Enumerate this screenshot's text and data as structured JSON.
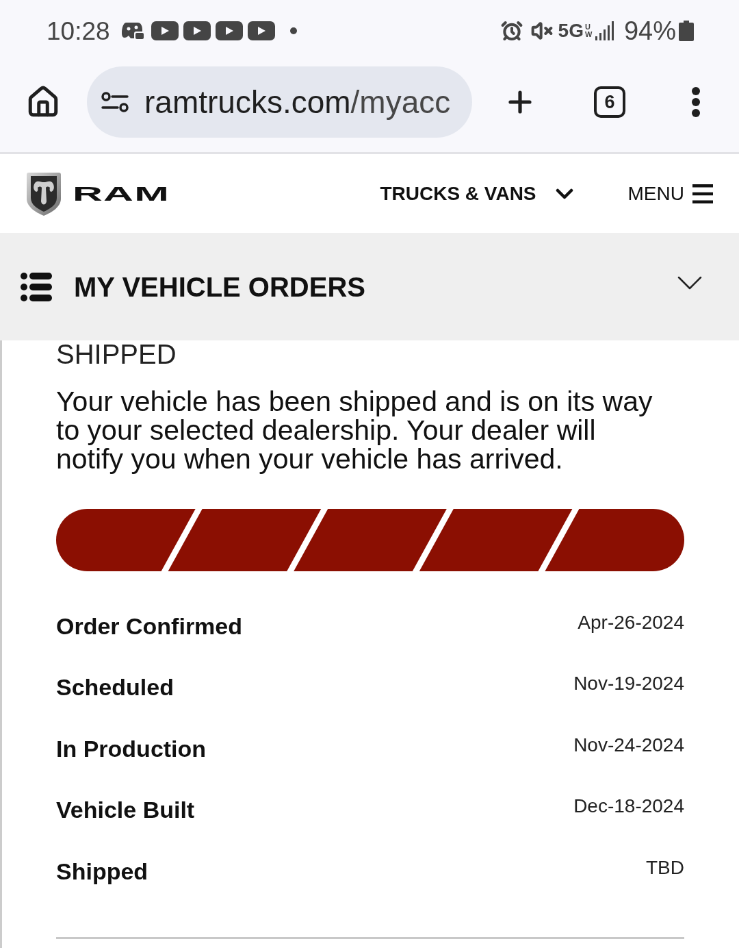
{
  "status_bar": {
    "time": "10:28",
    "network": "5G",
    "network_sub": "UW",
    "battery": "94%"
  },
  "browser": {
    "url_host": "ramtrucks.com",
    "url_path": "/myacc",
    "tab_count": "6"
  },
  "site_header": {
    "brand": "RAM",
    "nav": [
      {
        "label": "TRUCKS & VANS",
        "kind": "dropdown"
      },
      {
        "label": "MENU",
        "kind": "menu"
      }
    ]
  },
  "section_bar": {
    "title": "MY VEHICLE ORDERS",
    "expanded": false
  },
  "order": {
    "status": "SHIPPED",
    "message": "Your vehicle has been shipped and is on its way to your selected dealership. Your dealer will notify you when your vehicle has arrived.",
    "steps": [
      {
        "label": "Order Confirmed",
        "date": "Apr-26-2024",
        "completed": true
      },
      {
        "label": "Scheduled",
        "date": "Nov-19-2024",
        "completed": true
      },
      {
        "label": "In Production",
        "date": "Nov-24-2024",
        "completed": true
      },
      {
        "label": "Vehicle Built",
        "date": "Dec-18-2024",
        "completed": true
      },
      {
        "label": "Shipped",
        "date": "TBD",
        "completed": true
      }
    ]
  }
}
